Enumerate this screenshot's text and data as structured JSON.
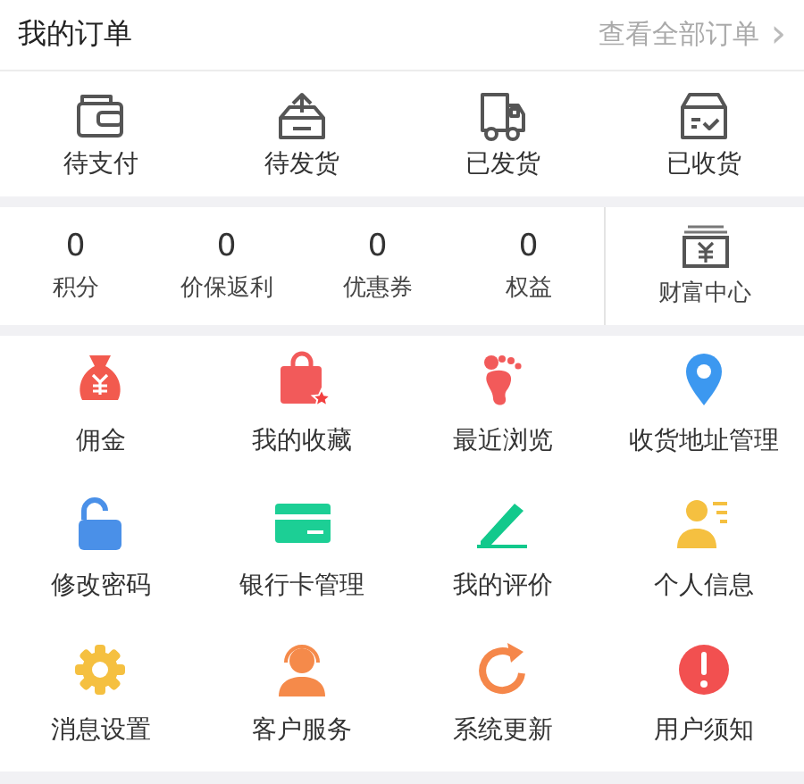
{
  "orders_header": {
    "title": "我的订单",
    "view_all": "查看全部订单",
    "chevron": "›"
  },
  "order_statuses": [
    {
      "label": "待支付"
    },
    {
      "label": "待发货"
    },
    {
      "label": "已发货"
    },
    {
      "label": "已收货"
    }
  ],
  "stats": [
    {
      "value": "0",
      "label": "积分"
    },
    {
      "value": "0",
      "label": "价保返利"
    },
    {
      "value": "0",
      "label": "优惠券"
    },
    {
      "value": "0",
      "label": "权益"
    }
  ],
  "wealth_center": {
    "label": "财富中心"
  },
  "services": [
    {
      "label": "佣金"
    },
    {
      "label": "我的收藏"
    },
    {
      "label": "最近浏览"
    },
    {
      "label": "收货地址管理"
    },
    {
      "label": "修改密码"
    },
    {
      "label": "银行卡管理"
    },
    {
      "label": "我的评价"
    },
    {
      "label": "个人信息"
    },
    {
      "label": "消息设置"
    },
    {
      "label": "客户服务"
    },
    {
      "label": "系统更新"
    },
    {
      "label": "用户须知"
    }
  ]
}
